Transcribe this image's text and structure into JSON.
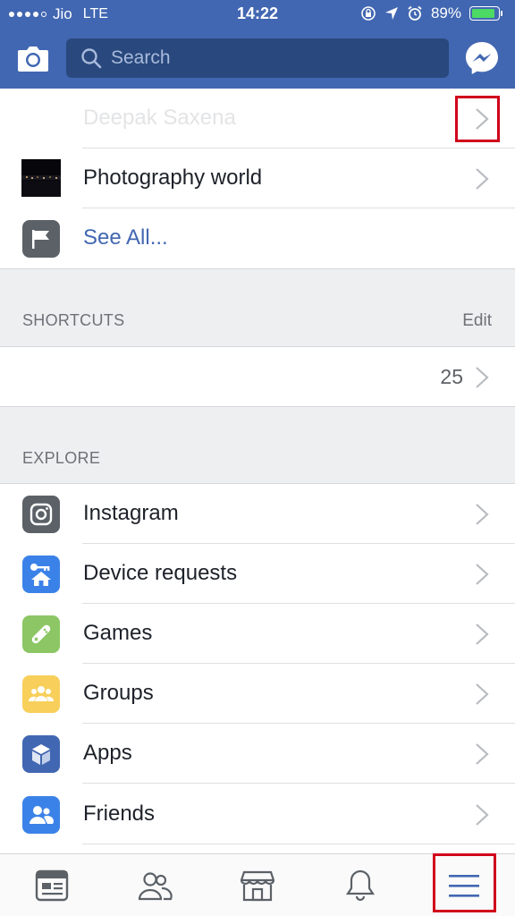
{
  "status_bar": {
    "carrier": "Jio",
    "network": "LTE",
    "time": "14:22",
    "battery": "89%",
    "battery_level": 0.89
  },
  "search": {
    "placeholder": "Search"
  },
  "pages": [
    {
      "label": "Deepak Saxena"
    },
    {
      "label": "Photography world"
    },
    {
      "label": "See All..."
    }
  ],
  "shortcuts": {
    "title": "SHORTCUTS",
    "edit": "Edit",
    "count": "25"
  },
  "explore": {
    "title": "EXPLORE",
    "items": [
      {
        "label": "Instagram",
        "icon": "instagram-icon",
        "color": "#5b6167"
      },
      {
        "label": "Device requests",
        "icon": "device-requests-icon",
        "color": "#3b82e8"
      },
      {
        "label": "Games",
        "icon": "games-icon",
        "color": "#8cc665"
      },
      {
        "label": "Groups",
        "icon": "groups-icon",
        "color": "#f7cf5a"
      },
      {
        "label": "Apps",
        "icon": "apps-icon",
        "color": "#4267b2"
      },
      {
        "label": "Friends",
        "icon": "friends-icon",
        "color": "#3b82e8"
      }
    ]
  },
  "colors": {
    "brand": "#4267b2",
    "link": "#4267b2",
    "highlight": "#d0021b"
  },
  "tabbar": {
    "tabs": [
      "news-feed-icon",
      "friend-requests-icon",
      "marketplace-icon",
      "notifications-icon",
      "menu-icon"
    ],
    "active": "menu-icon"
  }
}
